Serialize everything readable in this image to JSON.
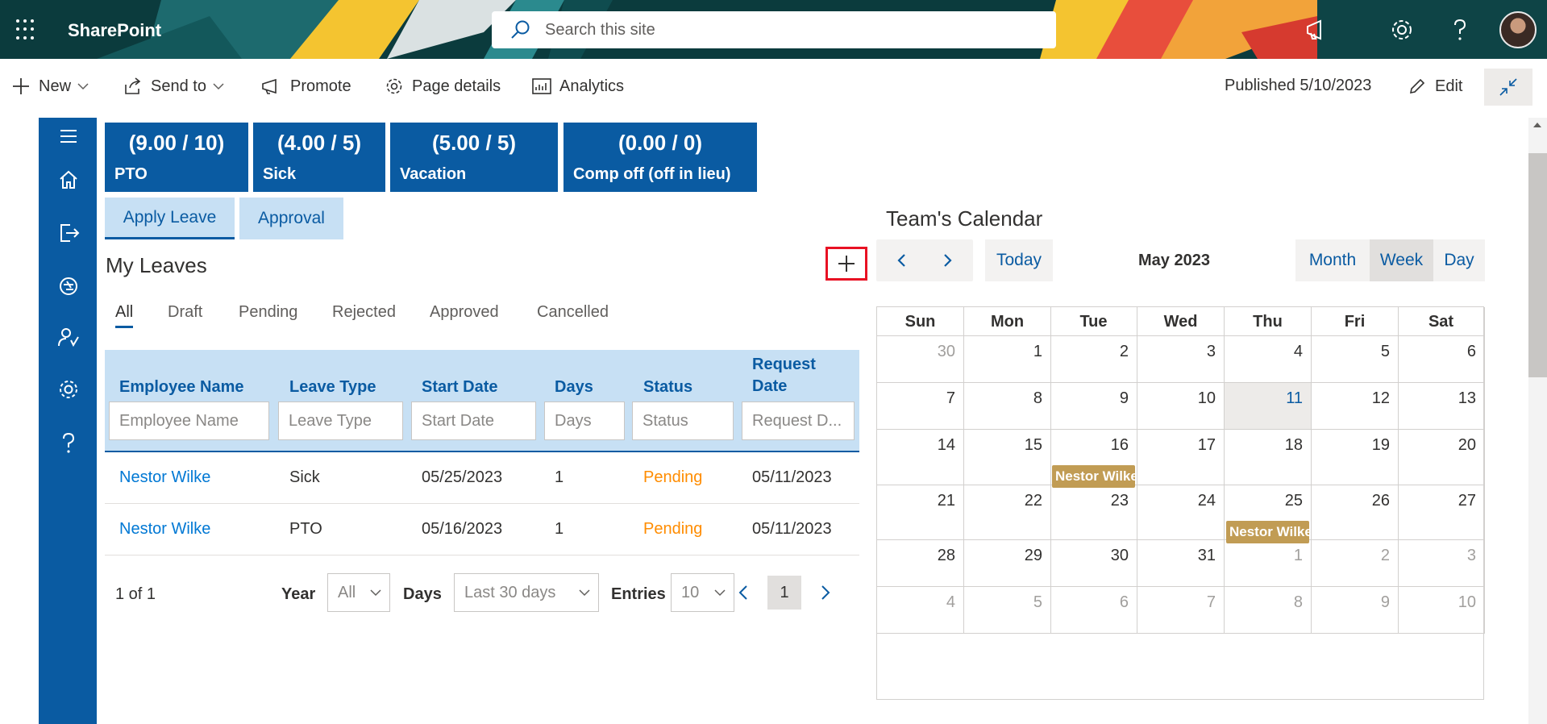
{
  "suite": {
    "brand": "SharePoint",
    "search_placeholder": "Search this site",
    "icons": [
      "waffle-icon",
      "megaphone-icon",
      "gear-icon",
      "help-icon",
      "avatar"
    ],
    "colors": {
      "header_bg": "#0b3b3d",
      "accent": "#0a5ba2"
    }
  },
  "command_bar": {
    "new_label": "New",
    "send_to_label": "Send to",
    "promote_label": "Promote",
    "page_details_label": "Page details",
    "analytics_label": "Analytics",
    "published_label": "Published 5/10/2023",
    "edit_label": "Edit"
  },
  "left_nav": {
    "icons": [
      "menu-icon",
      "home-icon",
      "sign-out-icon",
      "plane-icon",
      "person-approve-icon",
      "gear-icon",
      "help-icon"
    ]
  },
  "balances": [
    {
      "value": "(9.00 / 10)",
      "label": "PTO"
    },
    {
      "value": "(4.00 / 5)",
      "label": "Sick"
    },
    {
      "value": "(5.00 / 5)",
      "label": "Vacation"
    },
    {
      "value": "(0.00 / 0)",
      "label": "Comp off (off in lieu)"
    }
  ],
  "main_tabs": [
    {
      "label": "Apply Leave",
      "active": true
    },
    {
      "label": "Approval",
      "active": false
    }
  ],
  "my_leaves": {
    "title": "My Leaves",
    "filters": [
      "All",
      "Draft",
      "Pending",
      "Rejected",
      "Approved",
      "Cancelled"
    ],
    "active_filter": "All",
    "columns": [
      "Employee Name",
      "Leave Type",
      "Start Date",
      "Days",
      "Status",
      "Request Date"
    ],
    "column_placeholders": [
      "Employee Name",
      "Leave Type",
      "Start Date",
      "Days",
      "Status",
      "Request D..."
    ],
    "rows": [
      {
        "employee": "Nestor Wilke",
        "leave_type": "Sick",
        "start_date": "05/25/2023",
        "days": "1",
        "status": "Pending",
        "request_date": "05/11/2023"
      },
      {
        "employee": "Nestor Wilke",
        "leave_type": "PTO",
        "start_date": "05/16/2023",
        "days": "1",
        "status": "Pending",
        "request_date": "05/11/2023"
      }
    ],
    "pagination": {
      "summary": "1 of 1",
      "year_label": "Year",
      "year_value": "All",
      "days_label": "Days",
      "days_value": "Last 30 days",
      "entries_label": "Entries",
      "entries_value": "10",
      "current_page": "1"
    },
    "status_color": "#ff8c00",
    "link_color": "#0078d4"
  },
  "calendar": {
    "title": "Team's Calendar",
    "today_label": "Today",
    "month_label": "May 2023",
    "views": [
      "Month",
      "Week",
      "Day"
    ],
    "active_view": "Month",
    "day_names": [
      "Sun",
      "Mon",
      "Tue",
      "Wed",
      "Thu",
      "Fri",
      "Sat"
    ],
    "weeks": [
      [
        "30",
        "1",
        "2",
        "3",
        "4",
        "5",
        "6"
      ],
      [
        "7",
        "8",
        "9",
        "10",
        "11",
        "12",
        "13"
      ],
      [
        "14",
        "15",
        "16",
        "17",
        "18",
        "19",
        "20"
      ],
      [
        "21",
        "22",
        "23",
        "24",
        "25",
        "26",
        "27"
      ],
      [
        "28",
        "29",
        "30",
        "31",
        "1",
        "2",
        "3"
      ],
      [
        "4",
        "5",
        "6",
        "7",
        "8",
        "9",
        "10"
      ]
    ],
    "today": "11",
    "events": [
      {
        "date": "16",
        "title": "Nestor Wilke"
      },
      {
        "date": "25",
        "title": "Nestor Wilke"
      }
    ],
    "event_color": "#c19c54"
  }
}
